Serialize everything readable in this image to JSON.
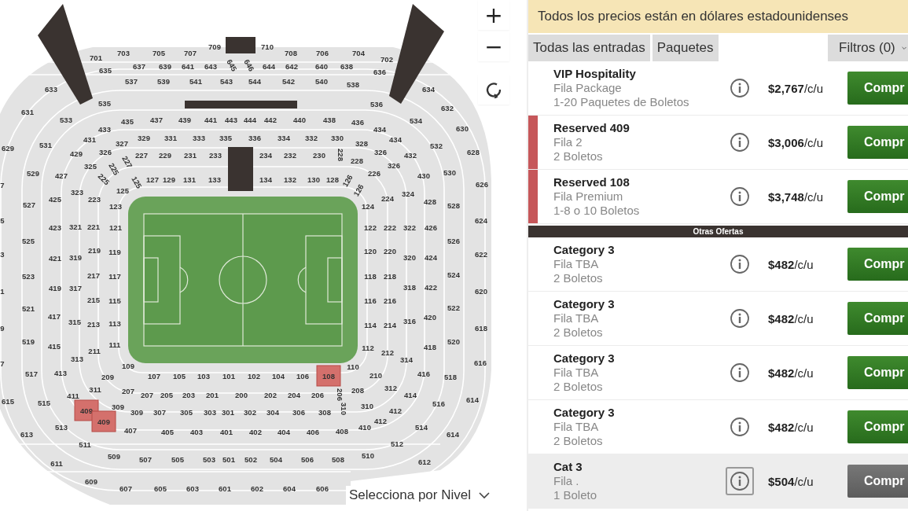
{
  "map": {
    "zoom_in": "+",
    "zoom_out": "−",
    "level_select": "Selecciona por Nivel",
    "sections": [
      {
        "label": "701",
        "selected": false
      },
      {
        "label": "703",
        "selected": false
      },
      {
        "label": "705",
        "selected": false
      },
      {
        "label": "707",
        "selected": false
      },
      {
        "label": "709",
        "selected": false
      },
      {
        "label": "710",
        "selected": false
      },
      {
        "label": "708",
        "selected": false
      },
      {
        "label": "706",
        "selected": false
      },
      {
        "label": "704",
        "selected": false
      },
      {
        "label": "702",
        "selected": false
      },
      {
        "label": "635",
        "selected": false
      },
      {
        "label": "637",
        "selected": false
      },
      {
        "label": "639",
        "selected": false
      },
      {
        "label": "641",
        "selected": false
      },
      {
        "label": "643",
        "selected": false
      },
      {
        "label": "645",
        "selected": false
      },
      {
        "label": "646",
        "selected": false
      },
      {
        "label": "644",
        "selected": false
      },
      {
        "label": "642",
        "selected": false
      },
      {
        "label": "640",
        "selected": false
      },
      {
        "label": "638",
        "selected": false
      },
      {
        "label": "636",
        "selected": false
      },
      {
        "label": "537",
        "selected": false
      },
      {
        "label": "539",
        "selected": false
      },
      {
        "label": "541",
        "selected": false
      },
      {
        "label": "543",
        "selected": false
      },
      {
        "label": "544",
        "selected": false
      },
      {
        "label": "542",
        "selected": false
      },
      {
        "label": "540",
        "selected": false
      },
      {
        "label": "538",
        "selected": false
      },
      {
        "label": "435",
        "selected": false
      },
      {
        "label": "437",
        "selected": false
      },
      {
        "label": "439",
        "selected": false
      },
      {
        "label": "441",
        "selected": false
      },
      {
        "label": "443",
        "selected": false
      },
      {
        "label": "444",
        "selected": false
      },
      {
        "label": "442",
        "selected": false
      },
      {
        "label": "440",
        "selected": false
      },
      {
        "label": "438",
        "selected": false
      },
      {
        "label": "436",
        "selected": false
      },
      {
        "label": "327",
        "selected": false
      },
      {
        "label": "329",
        "selected": false
      },
      {
        "label": "331",
        "selected": false
      },
      {
        "label": "333",
        "selected": false
      },
      {
        "label": "335",
        "selected": false
      },
      {
        "label": "336",
        "selected": false
      },
      {
        "label": "334",
        "selected": false
      },
      {
        "label": "332",
        "selected": false
      },
      {
        "label": "330",
        "selected": false
      },
      {
        "label": "328",
        "selected": false
      },
      {
        "label": "227",
        "selected": false
      },
      {
        "label": "229",
        "selected": false
      },
      {
        "label": "231",
        "selected": false
      },
      {
        "label": "233",
        "selected": false
      },
      {
        "label": "234",
        "selected": false
      },
      {
        "label": "232",
        "selected": false
      },
      {
        "label": "230",
        "selected": false
      },
      {
        "label": "228",
        "selected": false
      },
      {
        "label": "228",
        "selected": false
      },
      {
        "label": "127",
        "selected": false
      },
      {
        "label": "129",
        "selected": false
      },
      {
        "label": "131",
        "selected": false
      },
      {
        "label": "133",
        "selected": false
      },
      {
        "label": "134",
        "selected": false
      },
      {
        "label": "132",
        "selected": false
      },
      {
        "label": "130",
        "selected": false
      },
      {
        "label": "128",
        "selected": false
      },
      {
        "label": "633",
        "selected": false
      },
      {
        "label": "631",
        "selected": false
      },
      {
        "label": "629",
        "selected": false
      },
      {
        "label": "7",
        "selected": false
      },
      {
        "label": "535",
        "selected": false
      },
      {
        "label": "533",
        "selected": false
      },
      {
        "label": "531",
        "selected": false
      },
      {
        "label": "529",
        "selected": false
      },
      {
        "label": "433",
        "selected": false
      },
      {
        "label": "431",
        "selected": false
      },
      {
        "label": "429",
        "selected": false
      },
      {
        "label": "427",
        "selected": false
      },
      {
        "label": "425",
        "selected": false
      },
      {
        "label": "326",
        "selected": false
      },
      {
        "label": "325",
        "selected": false
      },
      {
        "label": "323",
        "selected": false
      },
      {
        "label": "227",
        "selected": false
      },
      {
        "label": "225",
        "selected": false
      },
      {
        "label": "225",
        "selected": false
      },
      {
        "label": "223",
        "selected": false
      },
      {
        "label": "125",
        "selected": false
      },
      {
        "label": "125",
        "selected": false
      },
      {
        "label": "123",
        "selected": false
      },
      {
        "label": "634",
        "selected": false
      },
      {
        "label": "632",
        "selected": false
      },
      {
        "label": "630",
        "selected": false
      },
      {
        "label": "628",
        "selected": false
      },
      {
        "label": "626",
        "selected": false
      },
      {
        "label": "536",
        "selected": false
      },
      {
        "label": "534",
        "selected": false
      },
      {
        "label": "532",
        "selected": false
      },
      {
        "label": "530",
        "selected": false
      },
      {
        "label": "528",
        "selected": false
      },
      {
        "label": "434",
        "selected": false
      },
      {
        "label": "434",
        "selected": false
      },
      {
        "label": "432",
        "selected": false
      },
      {
        "label": "430",
        "selected": false
      },
      {
        "label": "428",
        "selected": false
      },
      {
        "label": "326",
        "selected": false
      },
      {
        "label": "326",
        "selected": false
      },
      {
        "label": "324",
        "selected": false
      },
      {
        "label": "226",
        "selected": false
      },
      {
        "label": "224",
        "selected": false
      },
      {
        "label": "126",
        "selected": false
      },
      {
        "label": "126",
        "selected": false
      },
      {
        "label": "527",
        "selected": false
      },
      {
        "label": "124",
        "selected": false
      },
      {
        "label": "525",
        "selected": false
      },
      {
        "label": "523",
        "selected": false
      },
      {
        "label": "521",
        "selected": false
      },
      {
        "label": "519",
        "selected": false
      },
      {
        "label": "517",
        "selected": false
      },
      {
        "label": "5",
        "selected": false
      },
      {
        "label": "3",
        "selected": false
      },
      {
        "label": "1",
        "selected": false
      },
      {
        "label": "9",
        "selected": false
      },
      {
        "label": "7",
        "selected": false
      },
      {
        "label": "615",
        "selected": false
      },
      {
        "label": "423",
        "selected": false
      },
      {
        "label": "421",
        "selected": false
      },
      {
        "label": "419",
        "selected": false
      },
      {
        "label": "417",
        "selected": false
      },
      {
        "label": "415",
        "selected": false
      },
      {
        "label": "413",
        "selected": false
      },
      {
        "label": "321",
        "selected": false
      },
      {
        "label": "319",
        "selected": false
      },
      {
        "label": "317",
        "selected": false
      },
      {
        "label": "315",
        "selected": false
      },
      {
        "label": "313",
        "selected": false
      },
      {
        "label": "221",
        "selected": false
      },
      {
        "label": "219",
        "selected": false
      },
      {
        "label": "217",
        "selected": false
      },
      {
        "label": "215",
        "selected": false
      },
      {
        "label": "213",
        "selected": false
      },
      {
        "label": "211",
        "selected": false
      },
      {
        "label": "121",
        "selected": false
      },
      {
        "label": "119",
        "selected": false
      },
      {
        "label": "117",
        "selected": false
      },
      {
        "label": "115",
        "selected": false
      },
      {
        "label": "113",
        "selected": false
      },
      {
        "label": "111",
        "selected": false
      },
      {
        "label": "122",
        "selected": false
      },
      {
        "label": "120",
        "selected": false
      },
      {
        "label": "118",
        "selected": false
      },
      {
        "label": "116",
        "selected": false
      },
      {
        "label": "114",
        "selected": false
      },
      {
        "label": "112",
        "selected": false
      },
      {
        "label": "222",
        "selected": false
      },
      {
        "label": "220",
        "selected": false
      },
      {
        "label": "218",
        "selected": false
      },
      {
        "label": "216",
        "selected": false
      },
      {
        "label": "214",
        "selected": false
      },
      {
        "label": "212",
        "selected": false
      },
      {
        "label": "322",
        "selected": false
      },
      {
        "label": "320",
        "selected": false
      },
      {
        "label": "318",
        "selected": false
      },
      {
        "label": "316",
        "selected": false
      },
      {
        "label": "314",
        "selected": false
      },
      {
        "label": "312",
        "selected": false
      },
      {
        "label": "426",
        "selected": false
      },
      {
        "label": "424",
        "selected": false
      },
      {
        "label": "422",
        "selected": false
      },
      {
        "label": "420",
        "selected": false
      },
      {
        "label": "418",
        "selected": false
      },
      {
        "label": "416",
        "selected": false
      },
      {
        "label": "526",
        "selected": false
      },
      {
        "label": "524",
        "selected": false
      },
      {
        "label": "522",
        "selected": false
      },
      {
        "label": "520",
        "selected": false
      },
      {
        "label": "518",
        "selected": false
      },
      {
        "label": "516",
        "selected": false
      },
      {
        "label": "514",
        "selected": false
      },
      {
        "label": "512",
        "selected": false
      },
      {
        "label": "510",
        "selected": false
      },
      {
        "label": "624",
        "selected": false
      },
      {
        "label": "622",
        "selected": false
      },
      {
        "label": "620",
        "selected": false
      },
      {
        "label": "618",
        "selected": false
      },
      {
        "label": "616",
        "selected": false
      },
      {
        "label": "614",
        "selected": false
      },
      {
        "label": "614",
        "selected": false
      },
      {
        "label": "612",
        "selected": false
      },
      {
        "label": "109",
        "selected": false
      },
      {
        "label": "107",
        "selected": false
      },
      {
        "label": "105",
        "selected": false
      },
      {
        "label": "103",
        "selected": false
      },
      {
        "label": "101",
        "selected": false
      },
      {
        "label": "102",
        "selected": false
      },
      {
        "label": "104",
        "selected": false
      },
      {
        "label": "106",
        "selected": false
      },
      {
        "label": "108",
        "selected": true
      },
      {
        "label": "110",
        "selected": false
      },
      {
        "label": "209",
        "selected": false
      },
      {
        "label": "207",
        "selected": false
      },
      {
        "label": "207",
        "selected": false
      },
      {
        "label": "205",
        "selected": false
      },
      {
        "label": "203",
        "selected": false
      },
      {
        "label": "201",
        "selected": false
      },
      {
        "label": "200",
        "selected": false
      },
      {
        "label": "202",
        "selected": false
      },
      {
        "label": "204",
        "selected": false
      },
      {
        "label": "206",
        "selected": false
      },
      {
        "label": "206",
        "selected": false
      },
      {
        "label": "208",
        "selected": false
      },
      {
        "label": "210",
        "selected": false
      },
      {
        "label": "311",
        "selected": false
      },
      {
        "label": "309",
        "selected": false
      },
      {
        "label": "309",
        "selected": false
      },
      {
        "label": "307",
        "selected": false
      },
      {
        "label": "305",
        "selected": false
      },
      {
        "label": "303",
        "selected": false
      },
      {
        "label": "301",
        "selected": false
      },
      {
        "label": "302",
        "selected": false
      },
      {
        "label": "304",
        "selected": false
      },
      {
        "label": "306",
        "selected": false
      },
      {
        "label": "308",
        "selected": false
      },
      {
        "label": "310",
        "selected": false
      },
      {
        "label": "310",
        "selected": false
      },
      {
        "label": "411",
        "selected": false
      },
      {
        "label": "409",
        "selected": true
      },
      {
        "label": "409",
        "selected": true
      },
      {
        "label": "407",
        "selected": false
      },
      {
        "label": "405",
        "selected": false
      },
      {
        "label": "403",
        "selected": false
      },
      {
        "label": "401",
        "selected": false
      },
      {
        "label": "402",
        "selected": false
      },
      {
        "label": "404",
        "selected": false
      },
      {
        "label": "406",
        "selected": false
      },
      {
        "label": "408",
        "selected": false
      },
      {
        "label": "410",
        "selected": false
      },
      {
        "label": "412",
        "selected": false
      },
      {
        "label": "412",
        "selected": false
      },
      {
        "label": "414",
        "selected": false
      },
      {
        "label": "515",
        "selected": false
      },
      {
        "label": "513",
        "selected": false
      },
      {
        "label": "511",
        "selected": false
      },
      {
        "label": "509",
        "selected": false
      },
      {
        "label": "507",
        "selected": false
      },
      {
        "label": "505",
        "selected": false
      },
      {
        "label": "503",
        "selected": false
      },
      {
        "label": "501",
        "selected": false
      },
      {
        "label": "502",
        "selected": false
      },
      {
        "label": "504",
        "selected": false
      },
      {
        "label": "506",
        "selected": false
      },
      {
        "label": "508",
        "selected": false
      },
      {
        "label": "613",
        "selected": false
      },
      {
        "label": "611",
        "selected": false
      },
      {
        "label": "609",
        "selected": false
      },
      {
        "label": "607",
        "selected": false
      },
      {
        "label": "605",
        "selected": false
      },
      {
        "label": "603",
        "selected": false
      },
      {
        "label": "601",
        "selected": false
      },
      {
        "label": "602",
        "selected": false
      },
      {
        "label": "604",
        "selected": false
      },
      {
        "label": "606",
        "selected": false
      }
    ]
  },
  "panel": {
    "notice": "Todos los precios están en dólares estadounidenses",
    "tabs": [
      {
        "label": "Todas las entradas",
        "selected": false
      },
      {
        "label": "Paquetes",
        "selected": false
      }
    ],
    "filters": "Filtros (0)",
    "listings": [
      {
        "title": "VIP Hospitality",
        "row": "Fila Package",
        "quantity": "1-20 Paquetes de Boletos",
        "price": "**$2,767**/c/u",
        "button": "Compr",
        "highlighted": false,
        "disabled": false
      },
      {
        "title": "Reserved 409",
        "row": "Fila 2",
        "quantity": "2 Boletos",
        "price": "**$3,006**/c/u",
        "button": "Compr",
        "highlighted": true,
        "disabled": false
      },
      {
        "title": "Reserved 108",
        "row": "Fila Premium",
        "quantity": "1-8 o 10 Boletos",
        "price": "**$3,748**/c/u",
        "button": "Compr",
        "highlighted": true,
        "disabled": false
      }
    ],
    "other_offers": {
      "heading": "Otras Ofertas",
      "listings": [
        {
          "title": "Category 3",
          "row": "Fila TBA",
          "quantity": "2 Boletos",
          "price": "**$482**/c/u",
          "button": "Compr",
          "highlighted": false,
          "disabled": false
        },
        {
          "title": "Category 3",
          "row": "Fila TBA",
          "quantity": "2 Boletos",
          "price": "**$482**/c/u",
          "button": "Compr",
          "highlighted": false,
          "disabled": false
        },
        {
          "title": "Category 3",
          "row": "Fila TBA",
          "quantity": "2 Boletos",
          "price": "**$482**/c/u",
          "button": "Compr",
          "highlighted": false,
          "disabled": false
        },
        {
          "title": "Category 3",
          "row": "Fila TBA",
          "quantity": "2 Boletos",
          "price": "**$482**/c/u",
          "button": "Compr",
          "highlighted": false,
          "disabled": false
        },
        {
          "title": "Cat 3",
          "row": "Fila .",
          "quantity": "1 Boleto",
          "price": "**$504**/c/u",
          "button": "Compr",
          "highlighted": false,
          "disabled": true
        }
      ]
    }
  }
}
